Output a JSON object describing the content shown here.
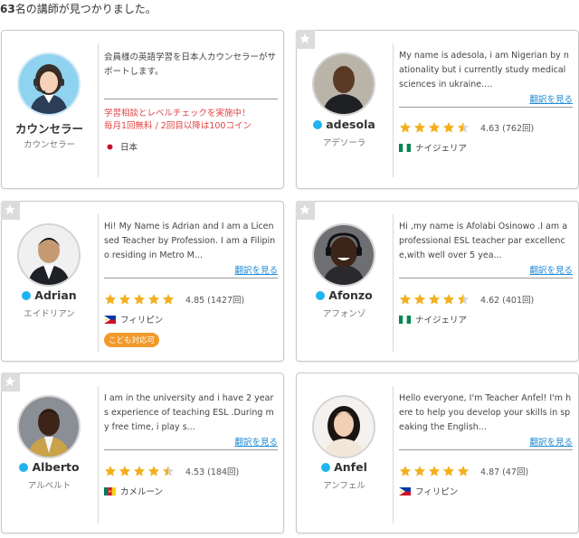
{
  "header": {
    "count": "63",
    "text": "名の講師が見つかりました。"
  },
  "cards": [
    {
      "name": "カウンセラー",
      "kana": "カウンセラー",
      "intro": "会員様の英語学習を日本人カウンセラーがサポートします。",
      "promo1": "学習相談とレベルチェックを実施中！",
      "promo2": "毎月1回無料 / 2回目以降は100コイン",
      "country": "日本",
      "flag": "japan-flag"
    },
    {
      "name": "adesola",
      "kana": "アデソーラ",
      "intro": "My name is adesola, i am Nigerian by nationality but i currently study medical sciences in ukraine....",
      "translate": "翻訳を見る",
      "rating": "4.63 (762回)",
      "stars": 4.5,
      "country": "ナイジェリア",
      "flag": "nigeria-flag"
    },
    {
      "name": "Adrian",
      "kana": "エイドリアン",
      "intro": "Hi! My Name is Adrian and I am a Licensed Teacher by Profession. I am a Filipino residing in Metro M...",
      "translate": "翻訳を見る",
      "rating": "4.85 (1427回)",
      "stars": 5,
      "country": "フィリピン",
      "flag": "philippines-flag",
      "badge": "こども対応可"
    },
    {
      "name": "Afonzo",
      "kana": "アフォンゾ",
      "intro": "Hi ,my name is Afolabi Osinowo .I am a professional ESL teacher par excellence,with well over 5 yea...",
      "translate": "翻訳を見る",
      "rating": "4.62 (401回)",
      "stars": 4.5,
      "country": "ナイジェリア",
      "flag": "nigeria-flag"
    },
    {
      "name": "Alberto",
      "kana": "アルベルト",
      "intro": "I am in the university and i have 2 years experience of teaching ESL .During my free time, i play s...",
      "translate": "翻訳を見る",
      "rating": "4.53 (184回)",
      "stars": 4.5,
      "country": "カメルーン",
      "flag": "cameroon-flag"
    },
    {
      "name": "Anfel",
      "kana": "アンフェル",
      "intro": "Hello everyone, I'm Teacher Anfel! I'm here to help you develop your skills in speaking the English...",
      "translate": "翻訳を見る",
      "rating": "4.87 (47回)",
      "stars": 5,
      "country": "フィリピン",
      "flag": "philippines-flag"
    }
  ],
  "colors": {
    "online": "#1fb4ef",
    "star": "#f2b01e",
    "link": "#1f8ad6",
    "promo": "#e24343",
    "badge": "#f19a2b"
  }
}
